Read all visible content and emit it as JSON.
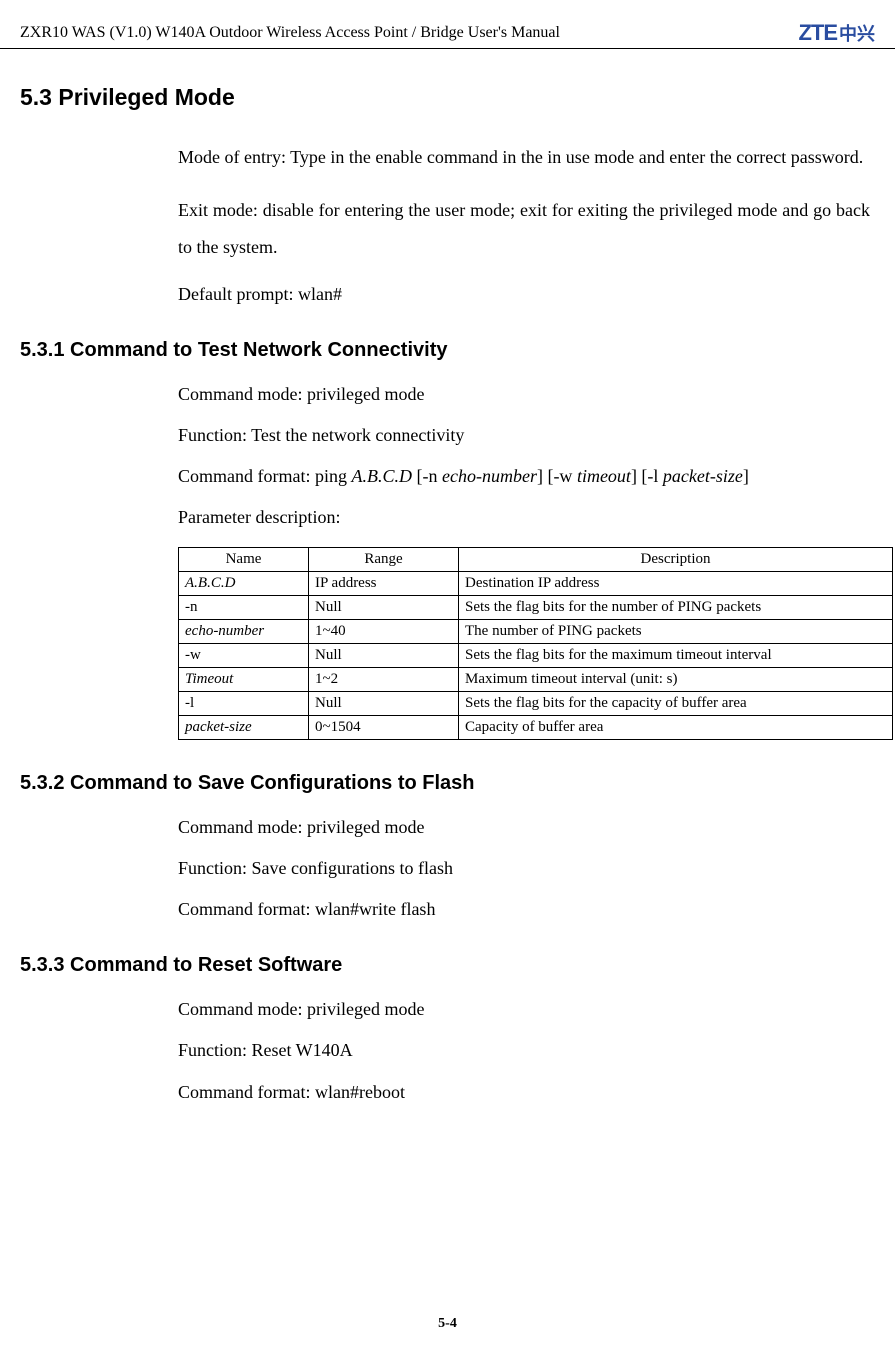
{
  "header": {
    "title": "ZXR10 WAS (V1.0) W140A Outdoor Wireless Access Point / Bridge    User's Manual",
    "logo_text": "ZTE",
    "logo_chinese": "中兴"
  },
  "section": {
    "title": "5.3 Privileged Mode",
    "para1": "Mode of entry: Type in the enable command in the in use mode and enter the correct password.",
    "para2": "Exit mode: disable for entering the user mode; exit for exiting the privileged mode and go back to the system.",
    "para3": "Default prompt: wlan#"
  },
  "sub1": {
    "title": "5.3.1 Command to Test Network Connectivity",
    "line1": "Command mode: privileged mode",
    "line2": "Function: Test the network connectivity",
    "cmd_prefix": "Command format: ping ",
    "cmd_abcd": "A.B.C.D",
    "cmd_n": " [-n ",
    "cmd_echo": "echo-number",
    "cmd_w": "] [-w ",
    "cmd_timeout": "timeout",
    "cmd_l": "] [-l ",
    "cmd_packet": "packet-size",
    "cmd_end": "]",
    "line4": "Parameter description:",
    "table": {
      "headers": {
        "name": "Name",
        "range": "Range",
        "desc": "Description"
      },
      "rows": [
        {
          "name": "A.B.C.D",
          "italic": true,
          "range": "IP address",
          "desc": "Destination IP address"
        },
        {
          "name": "-n",
          "italic": false,
          "range": "Null",
          "desc": "Sets the flag bits for the number of PING packets"
        },
        {
          "name": "echo-number",
          "italic": true,
          "range": "1~40",
          "desc": "The number of PING packets"
        },
        {
          "name": "-w",
          "italic": false,
          "range": "Null",
          "desc": "Sets the flag bits for the maximum timeout interval"
        },
        {
          "name": "Timeout",
          "italic": true,
          "range": "1~2",
          "desc": "Maximum timeout interval (unit: s)"
        },
        {
          "name": "-l",
          "italic": false,
          "range": "Null",
          "desc": "Sets the flag bits for the capacity of buffer area"
        },
        {
          "name": "packet-size",
          "italic": true,
          "range": "0~1504",
          "desc": "Capacity of buffer area"
        }
      ]
    }
  },
  "sub2": {
    "title": "5.3.2 Command to Save Configurations to Flash",
    "line1": "Command mode: privileged mode",
    "line2": "Function: Save configurations to flash",
    "line3": "Command format: wlan#write flash"
  },
  "sub3": {
    "title": "5.3.3 Command to Reset Software",
    "line1": "Command mode: privileged mode",
    "line2": "Function: Reset W140A",
    "line3": "Command format: wlan#reboot"
  },
  "footer": {
    "page": "5-4"
  }
}
